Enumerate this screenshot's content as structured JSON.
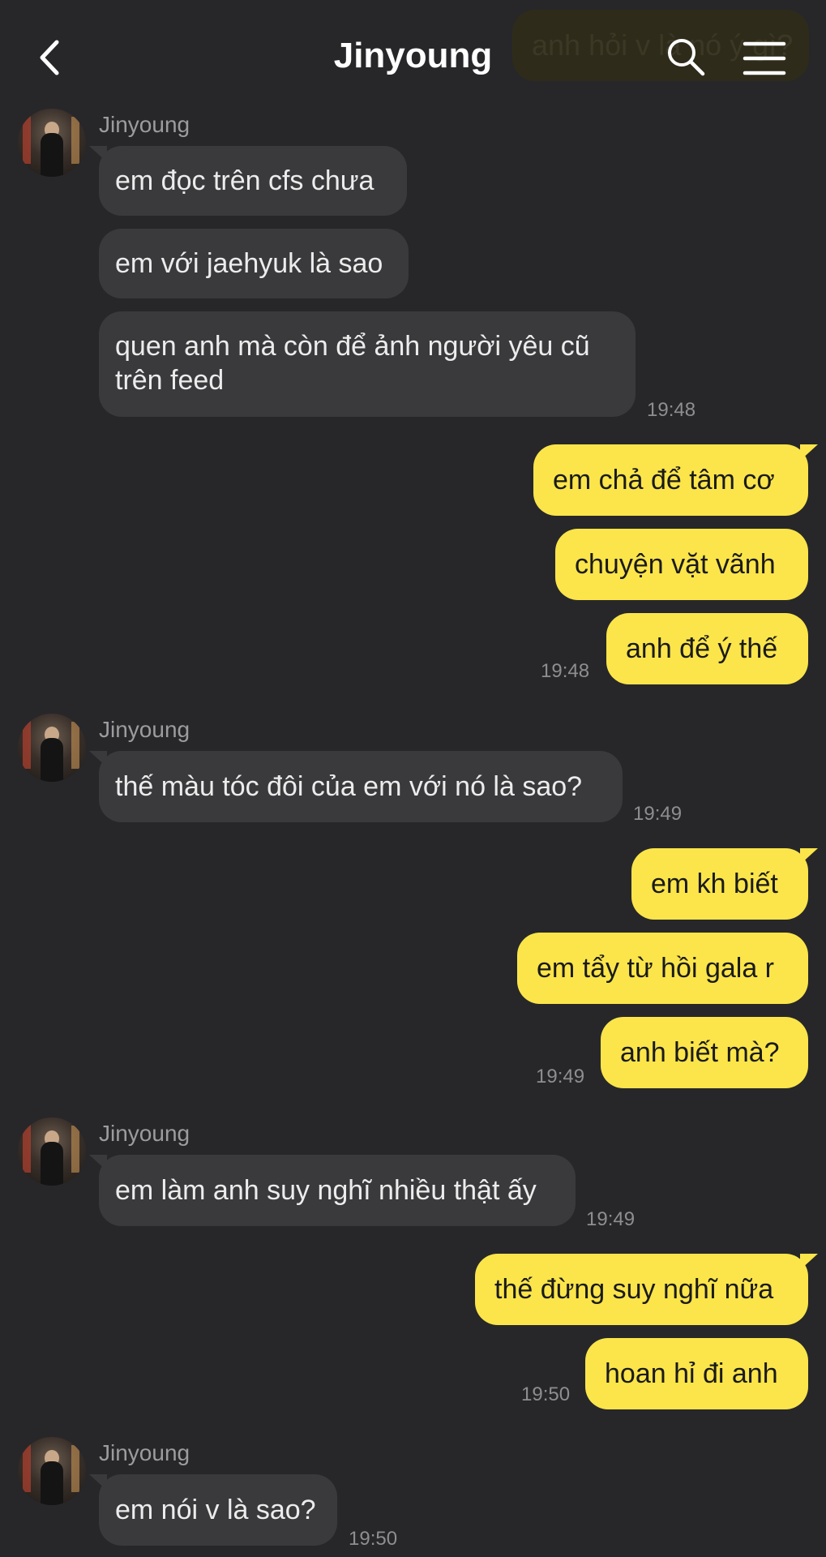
{
  "header": {
    "title": "Jinyoung",
    "peek_text": "anh hỏi v là nó ý gì?"
  },
  "conversation": {
    "g1": {
      "sender": "Jinyoung",
      "msgs": [
        "em đọc trên cfs chưa",
        "em với jaehyuk là sao",
        "quen anh mà còn để ảnh người yêu cũ trên feed"
      ],
      "time": "19:48"
    },
    "g2": {
      "msgs": [
        "em chả để tâm cơ",
        "chuyện vặt vãnh",
        "anh để ý thế"
      ],
      "time": "19:48"
    },
    "g3": {
      "sender": "Jinyoung",
      "msgs": [
        "thế màu tóc đôi của em với nó là sao?"
      ],
      "time": "19:49"
    },
    "g4": {
      "msgs": [
        "em kh biết",
        "em tẩy từ hồi gala r",
        "anh biết mà?"
      ],
      "time": "19:49"
    },
    "g5": {
      "sender": "Jinyoung",
      "msgs": [
        "em làm anh suy nghĩ nhiều thật ấy"
      ],
      "time": "19:49"
    },
    "g6": {
      "msgs": [
        "thế đừng suy nghĩ nữa",
        "hoan hỉ đi anh"
      ],
      "time": "19:50"
    },
    "g7": {
      "sender": "Jinyoung",
      "msgs": [
        "em nói v là sao?"
      ],
      "time": "19:50"
    }
  }
}
